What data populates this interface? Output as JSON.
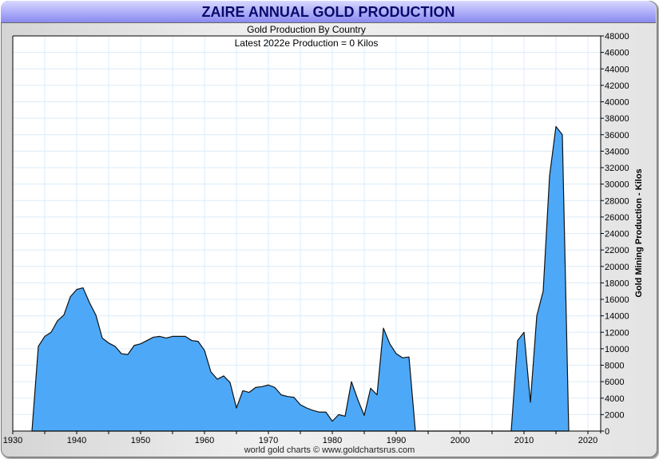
{
  "chart_data": {
    "type": "area",
    "title": "ZAIRE ANNUAL GOLD PRODUCTION",
    "subtitle": "Gold Production By Country",
    "annotation": "Latest 2022e Production = 0 Kilos",
    "xlabel": "",
    "ylabel": "Gold Mining Production - Kilos",
    "xlim": [
      1930,
      2022
    ],
    "ylim": [
      0,
      48000
    ],
    "x_ticks": [
      1930,
      1940,
      1950,
      1960,
      1970,
      1980,
      1990,
      2000,
      2010,
      2020
    ],
    "y_ticks": [
      0,
      2000,
      4000,
      6000,
      8000,
      10000,
      12000,
      14000,
      16000,
      18000,
      20000,
      22000,
      24000,
      26000,
      28000,
      30000,
      32000,
      34000,
      36000,
      38000,
      40000,
      42000,
      44000,
      46000,
      48000
    ],
    "grid": true,
    "fill_color": "#4da9f8",
    "x": [
      1933,
      1934,
      1935,
      1936,
      1937,
      1938,
      1939,
      1940,
      1941,
      1942,
      1943,
      1944,
      1945,
      1946,
      1947,
      1948,
      1949,
      1950,
      1951,
      1952,
      1953,
      1954,
      1955,
      1956,
      1957,
      1958,
      1959,
      1960,
      1961,
      1962,
      1963,
      1964,
      1965,
      1966,
      1967,
      1968,
      1969,
      1970,
      1971,
      1972,
      1973,
      1974,
      1975,
      1976,
      1977,
      1978,
      1979,
      1980,
      1981,
      1982,
      1983,
      1984,
      1985,
      1986,
      1987,
      1988,
      1989,
      1990,
      1991,
      1992,
      1993,
      2008,
      2009,
      2010,
      2011,
      2012,
      2013,
      2014,
      2015,
      2016,
      2017
    ],
    "values": [
      0,
      10300,
      11500,
      12000,
      13400,
      14100,
      16300,
      17200,
      17400,
      15600,
      14100,
      11300,
      10700,
      10300,
      9400,
      9300,
      10400,
      10600,
      11000,
      11400,
      11500,
      11300,
      11500,
      11500,
      11500,
      11000,
      10900,
      9800,
      7200,
      6300,
      6700,
      5900,
      2800,
      4900,
      4700,
      5300,
      5400,
      5600,
      5300,
      4400,
      4200,
      4100,
      3200,
      2800,
      2500,
      2300,
      2300,
      1200,
      2000,
      1800,
      6000,
      3800,
      1900,
      5200,
      4400,
      12500,
      10600,
      9400,
      8900,
      9000,
      0,
      0,
      11000,
      12000,
      3500,
      14000,
      17000,
      31000,
      37000,
      36000,
      0
    ]
  },
  "footer": "world gold charts © www.goldchartsrus.com"
}
